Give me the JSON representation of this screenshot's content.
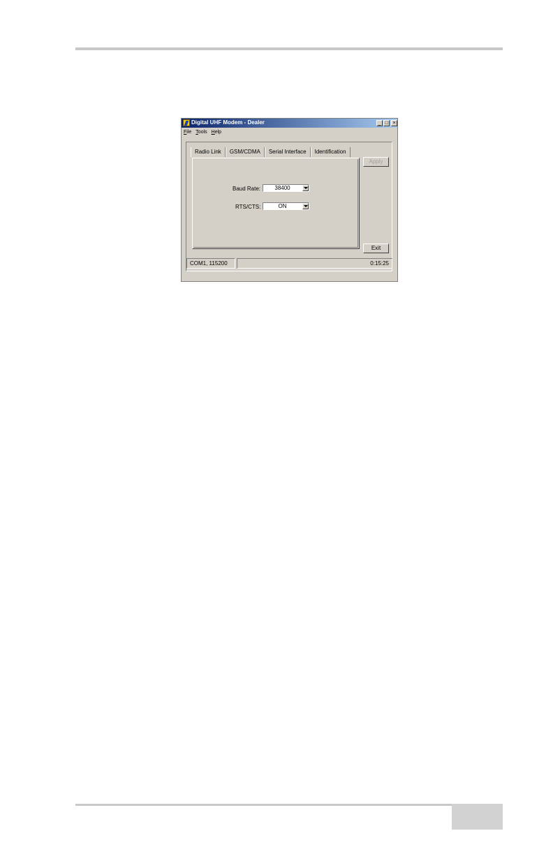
{
  "window": {
    "title": "Digital UHF Modem - Dealer",
    "controls": {
      "minimize": "_",
      "maximize": "□",
      "close": "×"
    }
  },
  "menu": [
    "File",
    "Tools",
    "Help"
  ],
  "tabs": [
    {
      "label": "Radio Link",
      "active": false
    },
    {
      "label": "GSM/CDMA",
      "active": false
    },
    {
      "label": "Serial Interface",
      "active": true
    },
    {
      "label": "Identification",
      "active": false
    }
  ],
  "serial_interface": {
    "baud_rate": {
      "label": "Baud Rate:",
      "value": "38400"
    },
    "rts_cts": {
      "label": "RTS/CTS:",
      "value": "ON"
    }
  },
  "buttons": {
    "apply": "Apply",
    "exit": "Exit"
  },
  "status": {
    "port": "COM1, 115200",
    "elapsed": "0:15:25"
  },
  "icons": [
    "app-icon",
    "minimize-icon",
    "maximize-icon",
    "close-icon",
    "dropdown-arrow-icon"
  ]
}
